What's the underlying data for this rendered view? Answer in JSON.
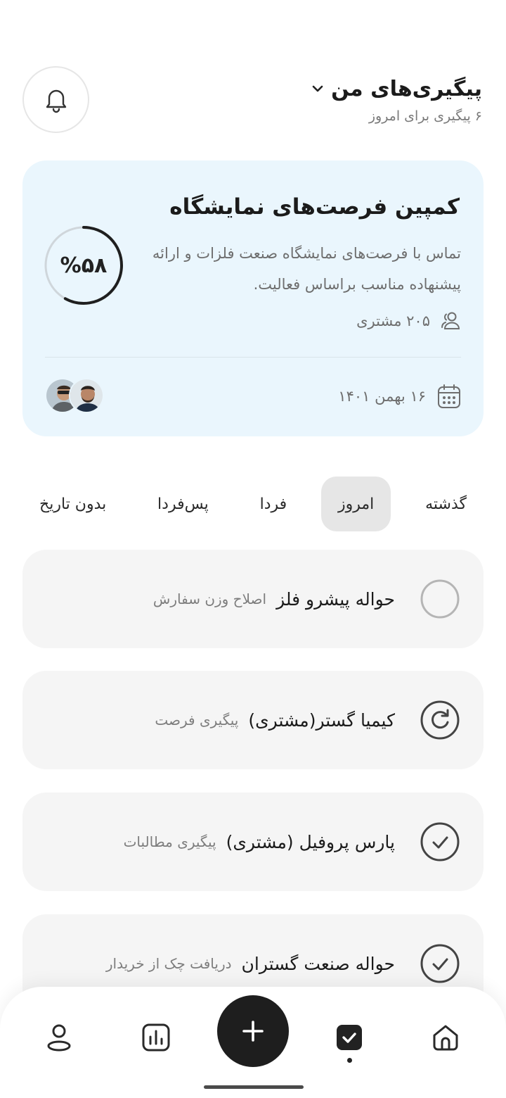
{
  "header": {
    "title": "پیگیری‌های من",
    "subtitle": "۶ پیگیری برای امروز"
  },
  "campaign": {
    "title": "کمپین فرصت‌های نمایشگاه",
    "description": "تماس با فرصت‌های نمایشگاه صنعت فلزات و ارائه پیشنهاده مناسب براساس فعالیت.",
    "progress_label": "%۵۸",
    "progress_value": 0.58,
    "customers": "۲۰۵ مشتری",
    "date": "۱۶ بهمن ۱۴۰۱"
  },
  "tabs": [
    {
      "label": "گذشته",
      "active": false
    },
    {
      "label": "امروز",
      "active": true
    },
    {
      "label": "فردا",
      "active": false
    },
    {
      "label": "پس‌فردا",
      "active": false
    },
    {
      "label": "بدون تاریخ",
      "active": false
    }
  ],
  "followups": [
    {
      "title": "حواله پیشرو فلز",
      "subtitle": "اصلاح وزن سفارش",
      "status": "empty-circle-icon"
    },
    {
      "title": "کیمیا گستر(مشتری)",
      "subtitle": "پیگیری فرصت",
      "status": "refresh-icon"
    },
    {
      "title": "پارس پروفیل (مشتری)",
      "subtitle": "پیگیری مطالبات",
      "status": "check-circle-icon"
    },
    {
      "title": "حواله صنعت گستران",
      "subtitle": "دریافت چک از خریدار",
      "status": "check-circle-icon"
    }
  ],
  "colors": {
    "card_bg": "#eaf6fd",
    "item_bg": "#f5f5f5",
    "fab_bg": "#1e1e1e",
    "active_tab_bg": "#e6e6e6"
  }
}
